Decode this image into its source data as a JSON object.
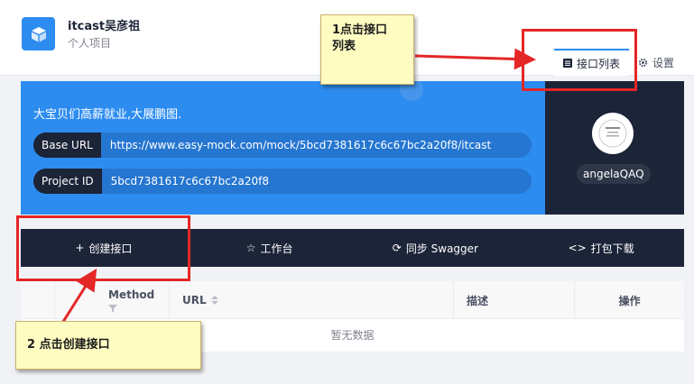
{
  "project": {
    "name": "itcast吴彦祖",
    "subtitle": "个人项目"
  },
  "tabs": [
    {
      "label": "接口列表",
      "icon": "list-icon",
      "active": true
    },
    {
      "label": "设置",
      "icon": "gear-icon",
      "active": false
    }
  ],
  "banner": {
    "slogan": "大宝贝们高薪就业,大展鹏图.",
    "base_url_label": "Base URL",
    "base_url": "https://www.easy-mock.com/mock/5bcd7381617c6c67bc2a20f8/itcast",
    "project_id_label": "Project ID",
    "project_id": "5bcd7381617c6c67bc2a20f8"
  },
  "user": {
    "name": "angelaQAQ"
  },
  "toolbar": [
    {
      "label": "创建接口",
      "icon": "plus-icon"
    },
    {
      "label": "工作台",
      "icon": "star-icon"
    },
    {
      "label": "同步 Swagger",
      "icon": "sync-icon"
    },
    {
      "label": "打包下载",
      "icon": "code-icon"
    }
  ],
  "table": {
    "columns": [
      "Method",
      "URL",
      "描述",
      "操作"
    ],
    "empty_text": "暂无数据"
  },
  "annotations": [
    {
      "text": "1点击接口\n列表"
    },
    {
      "text": "2 点击创建接口"
    }
  ],
  "colors": {
    "primary": "#2d8cf0",
    "dark": "#1c2438",
    "annotation_red": "#e52626",
    "note_bg": "#fffcc2"
  }
}
